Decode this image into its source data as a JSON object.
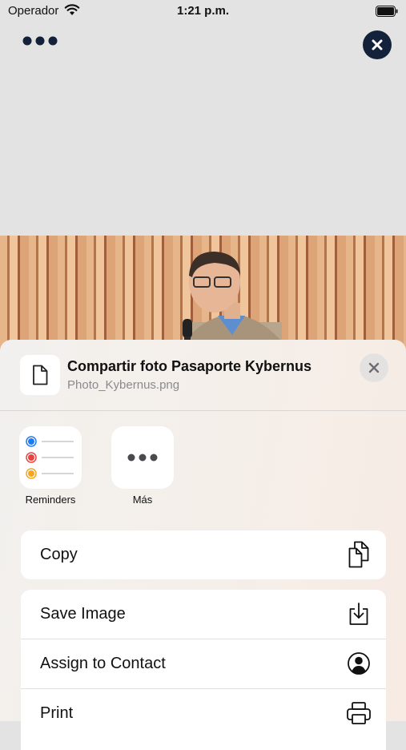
{
  "status_bar": {
    "carrier": "Operador",
    "time": "1:21 p.m."
  },
  "top_bar": {
    "more_icon": "ellipsis-icon",
    "close_icon": "close-circle-icon"
  },
  "share_sheet": {
    "title": "Compartir foto Pasaporte Kybernus",
    "subtitle": "Photo_Kybernus.png",
    "apps": [
      {
        "label": "Reminders",
        "icon": "reminders-icon"
      },
      {
        "label": "Más",
        "icon": "ellipsis-icon"
      }
    ],
    "actions_group1": [
      {
        "label": "Copy",
        "icon": "copy-icon"
      }
    ],
    "actions_group2": [
      {
        "label": "Save Image",
        "icon": "save-download-icon"
      },
      {
        "label": "Assign to Contact",
        "icon": "person-circle-icon"
      },
      {
        "label": "Print",
        "icon": "printer-icon"
      }
    ]
  },
  "colors": {
    "dark_navy": "#14213a",
    "reminder_blue": "#1e7cf2",
    "reminder_red": "#e8433c",
    "reminder_orange": "#f4a623"
  }
}
